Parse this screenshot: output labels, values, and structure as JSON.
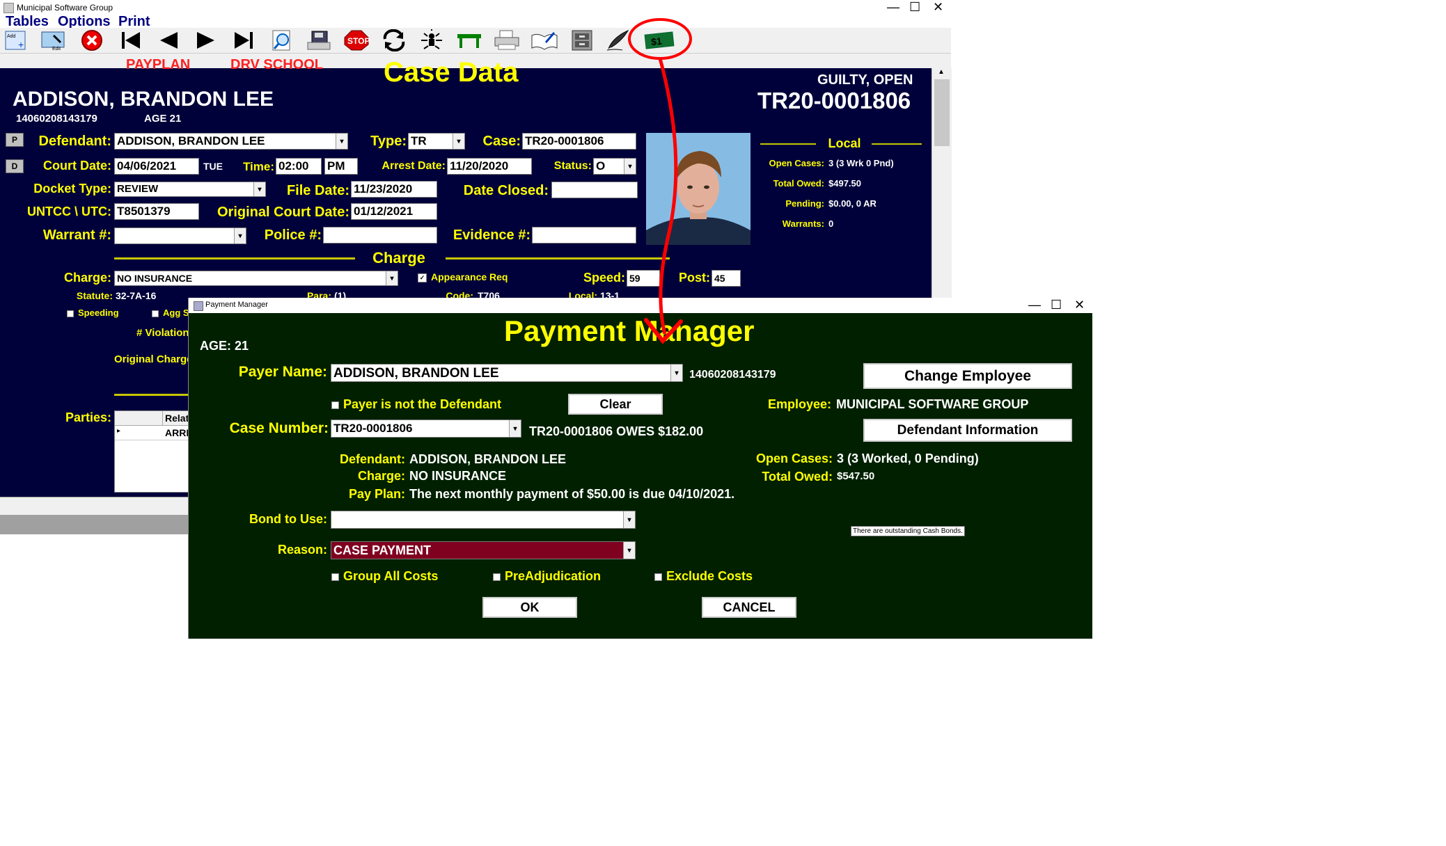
{
  "main_window": {
    "title": "Municipal Software Group",
    "menu": [
      "Tables",
      "Options",
      "Print"
    ],
    "window_controls": [
      "—",
      "☐",
      "✕"
    ],
    "toolbar": [
      {
        "icon": "add-record-icon",
        "label": "Add Record"
      },
      {
        "icon": "edit-icon",
        "label": "Edit"
      },
      {
        "icon": "delete-icon"
      },
      {
        "icon": "first-record-icon"
      },
      {
        "icon": "previous-record-icon"
      },
      {
        "icon": "next-record-icon"
      },
      {
        "icon": "last-record-icon"
      },
      {
        "icon": "search-icon"
      },
      {
        "icon": "save-icon"
      },
      {
        "icon": "stop-icon",
        "label": "STOP"
      },
      {
        "icon": "refresh-icon"
      },
      {
        "icon": "organization-icon"
      },
      {
        "icon": "table-icon"
      },
      {
        "icon": "printer-icon"
      },
      {
        "icon": "book-icon"
      },
      {
        "icon": "file-cabinet-icon"
      },
      {
        "icon": "quill-pen-icon"
      },
      {
        "icon": "payment-dollar-icon",
        "label": "$1"
      }
    ]
  },
  "case": {
    "payplan": "PAYPLAN",
    "drv_school": "DRV SCHOOL",
    "title": "Case Data",
    "status_line": "GUILTY, OPEN",
    "case_number": "TR20-0001806",
    "name": "ADDISON, BRANDON LEE",
    "id_number": "14060208143179",
    "age": "AGE  21",
    "side_buttons": [
      "P",
      "D"
    ],
    "fields": {
      "defendant_label": "Defendant:",
      "defendant": "ADDISON, BRANDON LEE",
      "type_label": "Type:",
      "type": "TR",
      "case_label": "Case:",
      "case": "TR20-0001806",
      "court_date_label": "Court Date:",
      "court_date": "04/06/2021",
      "court_day": "TUE",
      "time_label": "Time:",
      "time": "02:00",
      "ampm": "PM",
      "arrest_date_label": "Arrest Date:",
      "arrest_date": "11/20/2020",
      "status_label": "Status:",
      "status": "O",
      "docket_type_label": "Docket Type:",
      "docket_type": "REVIEW",
      "file_date_label": "File Date:",
      "file_date": "11/23/2020",
      "date_closed_label": "Date Closed:",
      "date_closed": "",
      "untcc_label": "UNTCC \\ UTC:",
      "untcc": "T8501379",
      "original_court_date_label": "Original Court Date:",
      "original_court_date": "01/12/2021",
      "warrant_label": "Warrant #:",
      "warrant": "",
      "police_label": "Police #:",
      "police": "",
      "evidence_label": "Evidence #:",
      "evidence": ""
    },
    "charge_section": {
      "heading": "Charge",
      "charge_label": "Charge:",
      "charge": "NO INSURANCE",
      "appearance_req": "Appearance Req",
      "speed_label": "Speed:",
      "speed": "59",
      "post_label": "Post:",
      "post": "45",
      "statute_label": "Statute:",
      "statute": "32-7A-16",
      "para_label": "Para:",
      "para": "(1)",
      "code_label": "Code:",
      "code": "T706",
      "local_label": "Local:",
      "local": "13-1",
      "speeding": "Speeding",
      "agg": "Agg Sp",
      "violations": "# Violation",
      "original_charge": "Original Charge",
      "parties_label": "Parties:",
      "parties_col": "Relat",
      "parties_row": "ARRE"
    },
    "local_panel": {
      "heading": "Local",
      "open_cases_label": "Open Cases:",
      "open_cases": "3 (3 Wrk  0 Pnd)",
      "total_owed_label": "Total Owed:",
      "total_owed": "$497.50",
      "pending_label": "Pending:",
      "pending": "$0.00,  0 AR",
      "warrants_label": "Warrants:",
      "warrants": "0"
    }
  },
  "payment_manager": {
    "window_title": "Payment Manager",
    "title": "Payment Manager",
    "age": "AGE: 21",
    "payer_name_label": "Payer Name:",
    "payer_name": "ADDISON, BRANDON LEE",
    "payer_id": "14060208143179",
    "change_employee": "Change Employee",
    "payer_not_defendant": "Payer is not the Defendant",
    "clear": "Clear",
    "employee_label": "Employee:",
    "employee": "MUNICIPAL SOFTWARE GROUP",
    "case_number_label": "Case Number:",
    "case_number": "TR20-0001806",
    "owes_text": "TR20-0001806 OWES $182.00",
    "defendant_information": "Defendant Information",
    "defendant_label": "Defendant:",
    "defendant": "ADDISON, BRANDON LEE",
    "charge_label": "Charge:",
    "charge": "NO INSURANCE",
    "pay_plan_label": "Pay Plan:",
    "pay_plan": "The next monthly payment of $50.00 is due 04/10/2021.",
    "open_cases_label": "Open Cases:",
    "open_cases": "3 (3 Worked, 0 Pending)",
    "total_owed_label": "Total Owed:",
    "total_owed": "$547.50",
    "bond_label": "Bond to Use:",
    "bond": "",
    "cash_bonds_note": "There are outstanding Cash Bonds.",
    "reason_label": "Reason:",
    "reason": "CASE PAYMENT",
    "group_all_costs": "Group All Costs",
    "preadjudication": "PreAdjudication",
    "exclude_costs": "Exclude Costs",
    "ok": "OK",
    "cancel": "CANCEL"
  },
  "colors": {
    "case_bg": "#00003a",
    "payment_bg": "#002000",
    "label_yellow": "#ffff00",
    "red_text": "#ff2020",
    "annotation_red": "#ff0000",
    "reason_bg": "#800020"
  }
}
